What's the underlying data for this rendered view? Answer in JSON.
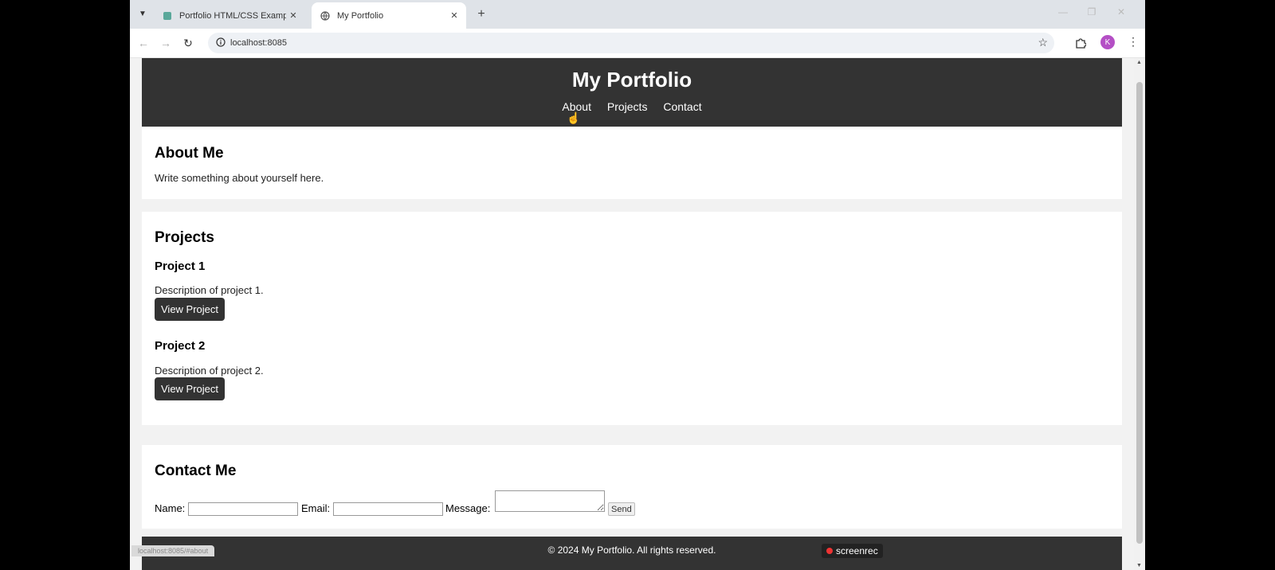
{
  "browser": {
    "tabs": [
      {
        "title": "Portfolio HTML/CSS Example",
        "active": false
      },
      {
        "title": "My Portfolio",
        "active": true
      }
    ],
    "address": "localhost:8085",
    "profile_initial": "K",
    "status_url": "localhost:8085/#about"
  },
  "page": {
    "header": {
      "title": "My Portfolio",
      "nav": [
        "About",
        "Projects",
        "Contact"
      ]
    },
    "about": {
      "heading": "About Me",
      "text": "Write something about yourself here."
    },
    "projects": {
      "heading": "Projects",
      "items": [
        {
          "title": "Project 1",
          "description": "Description of project 1.",
          "button": "View Project"
        },
        {
          "title": "Project 2",
          "description": "Description of project 2.",
          "button": "View Project"
        }
      ]
    },
    "contact": {
      "heading": "Contact Me",
      "name_label": "Name:",
      "email_label": "Email:",
      "message_label": "Message:",
      "send_label": "Send"
    },
    "footer": "© 2024 My Portfolio. All rights reserved."
  },
  "overlay": {
    "screenrec": "screenrec"
  },
  "colors": {
    "header_bg": "#333333",
    "page_bg": "#f2f2f2",
    "profile_avatar": "#b44fc5"
  }
}
